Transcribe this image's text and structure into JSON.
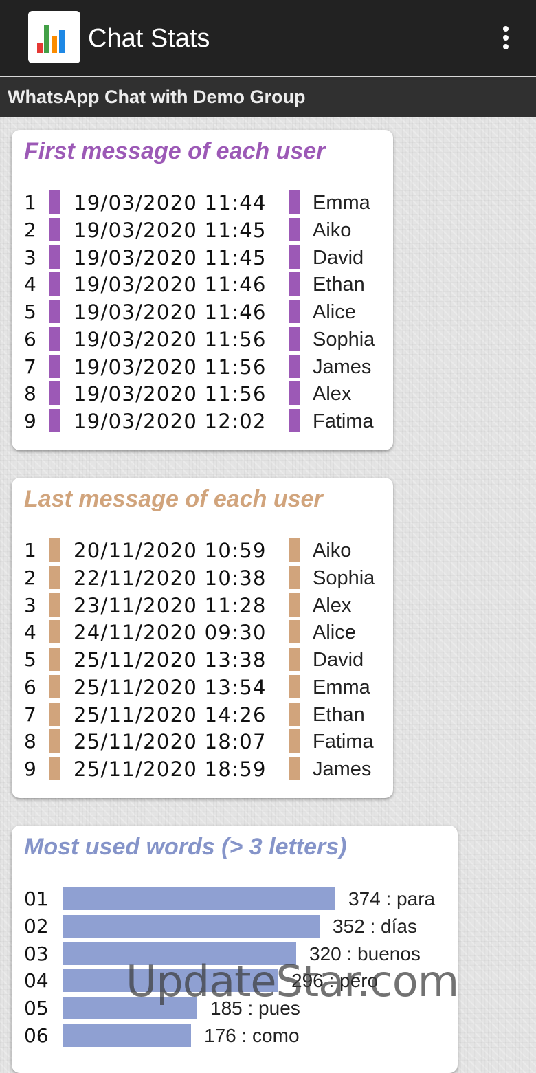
{
  "app": {
    "title": "Chat Stats",
    "logo_icon": "bar-chart-logo",
    "menu_icon": "more-vertical-icon",
    "subtitle": "WhatsApp Chat with Demo Group"
  },
  "first_messages": {
    "title": "First message of each user",
    "color": "#9c59b6",
    "rows": [
      {
        "rank": "1",
        "datetime": "19/03/2020  11:44",
        "user": "Emma"
      },
      {
        "rank": "2",
        "datetime": "19/03/2020  11:45",
        "user": "Aiko"
      },
      {
        "rank": "3",
        "datetime": "19/03/2020  11:45",
        "user": "David"
      },
      {
        "rank": "4",
        "datetime": "19/03/2020  11:46",
        "user": "Ethan"
      },
      {
        "rank": "5",
        "datetime": "19/03/2020  11:46",
        "user": "Alice"
      },
      {
        "rank": "6",
        "datetime": "19/03/2020  11:56",
        "user": "Sophia"
      },
      {
        "rank": "7",
        "datetime": "19/03/2020  11:56",
        "user": "James"
      },
      {
        "rank": "8",
        "datetime": "19/03/2020  11:56",
        "user": "Alex"
      },
      {
        "rank": "9",
        "datetime": "19/03/2020  12:02",
        "user": "Fatima"
      }
    ]
  },
  "last_messages": {
    "title": "Last message of each user",
    "color": "#d1a47c",
    "rows": [
      {
        "rank": "1",
        "datetime": "20/11/2020  10:59",
        "user": "Aiko"
      },
      {
        "rank": "2",
        "datetime": "22/11/2020  10:38",
        "user": "Sophia"
      },
      {
        "rank": "3",
        "datetime": "23/11/2020  11:28",
        "user": "Alex"
      },
      {
        "rank": "4",
        "datetime": "24/11/2020  09:30",
        "user": "Alice"
      },
      {
        "rank": "5",
        "datetime": "25/11/2020  13:38",
        "user": "David"
      },
      {
        "rank": "6",
        "datetime": "25/11/2020  13:54",
        "user": "Emma"
      },
      {
        "rank": "7",
        "datetime": "25/11/2020  14:26",
        "user": "Ethan"
      },
      {
        "rank": "8",
        "datetime": "25/11/2020  18:07",
        "user": "Fatima"
      },
      {
        "rank": "9",
        "datetime": "25/11/2020  18:59",
        "user": "James"
      }
    ]
  },
  "most_used_words": {
    "title": "Most used words (> 3 letters)",
    "color": "#8594c9",
    "bar_color": "#8fa0d2"
  },
  "chart_data": {
    "type": "bar",
    "orientation": "horizontal",
    "title": "Most used words (> 3 letters)",
    "categories": [
      "01",
      "02",
      "03",
      "04",
      "05",
      "06"
    ],
    "labels": [
      "374 : para",
      "352 : días",
      "320 : buenos",
      "296 : pero",
      "185 : pues",
      "176 : como"
    ],
    "words": [
      "para",
      "días",
      "buenos",
      "pero",
      "pues",
      "como"
    ],
    "values": [
      374,
      352,
      320,
      296,
      185,
      176
    ],
    "xlim": [
      0,
      374
    ],
    "grid": false,
    "legend": "none"
  },
  "watermark": "UpdateStar.com"
}
